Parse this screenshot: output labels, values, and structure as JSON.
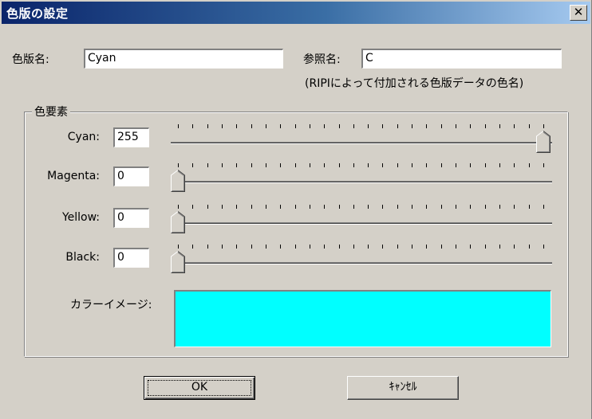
{
  "window": {
    "title": "色版の設定",
    "close_glyph": "✕"
  },
  "plate_name": {
    "label": "色版名:",
    "value": "Cyan"
  },
  "reference_name": {
    "label": "参照名:",
    "value": "C",
    "note": "(RIPIによって付加される色版データの色名)"
  },
  "color_elements": {
    "legend": "色要素",
    "channels": [
      {
        "label": "Cyan:",
        "value": "255",
        "level": 255
      },
      {
        "label": "Magenta:",
        "value": "0",
        "level": 0
      },
      {
        "label": "Yellow:",
        "value": "0",
        "level": 0
      },
      {
        "label": "Black:",
        "value": "0",
        "level": 0
      }
    ],
    "slider_max": 255,
    "tick_count": 26
  },
  "color_image": {
    "label": "カラーイメージ:",
    "color": "#00ffff"
  },
  "buttons": {
    "ok": "OK",
    "cancel": "ｷｬﾝｾﾙ"
  }
}
